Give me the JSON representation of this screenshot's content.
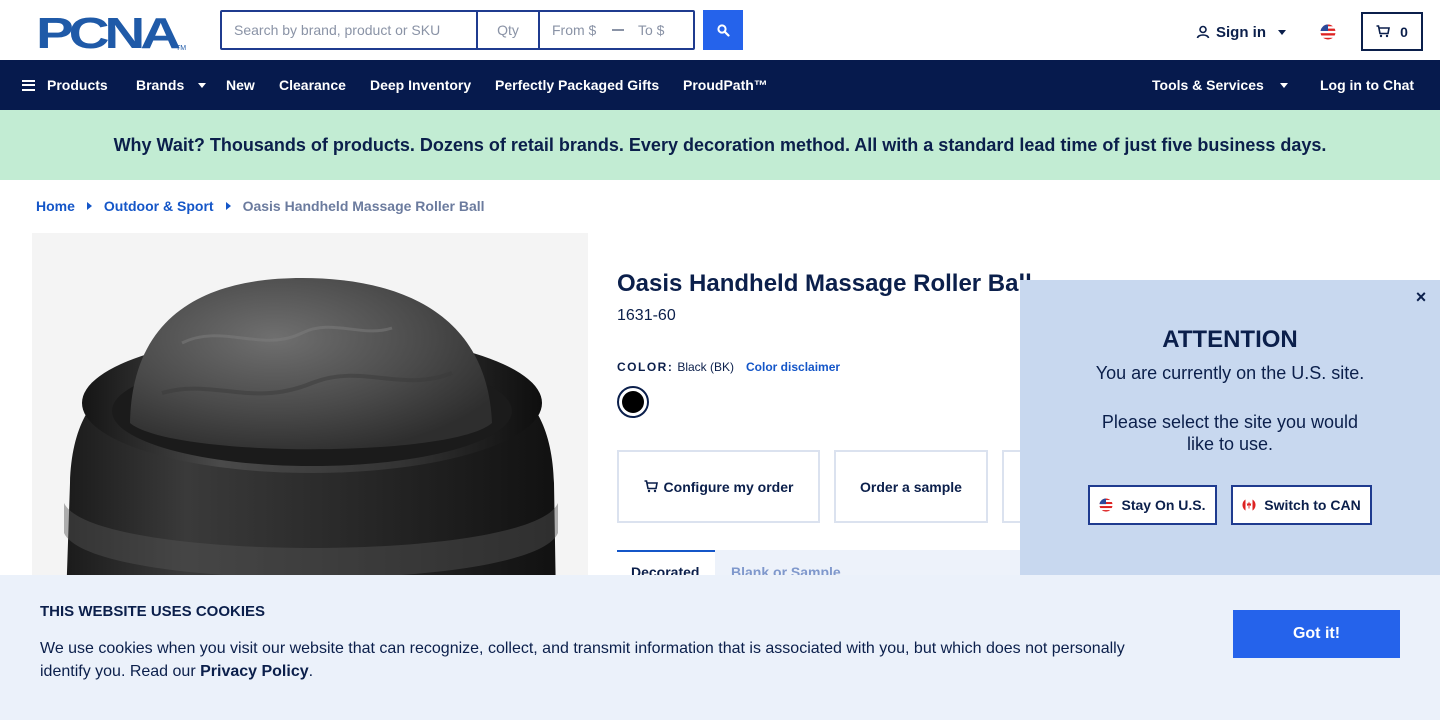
{
  "header": {
    "logo_text": "PCNA",
    "search": {
      "sku_placeholder": "Search by brand, product or SKU",
      "qty_placeholder": "Qty",
      "from_placeholder": "From $",
      "to_placeholder": "To $"
    },
    "sign_in_label": "Sign in",
    "cart_count": "0",
    "brand_color": "#1f5aa8"
  },
  "nav": {
    "products": "Products",
    "brands": "Brands",
    "new": "New",
    "clearance": "Clearance",
    "deep_inventory": "Deep Inventory",
    "gifts": "Perfectly Packaged Gifts",
    "proudpath": "ProudPath™",
    "tools": "Tools & Services",
    "chat": "Log in to Chat"
  },
  "promo": {
    "text": "Why Wait? Thousands of products. Dozens of retail brands. Every decoration method. All with a standard lead time of just five business days."
  },
  "breadcrumb": {
    "home": "Home",
    "category": "Outdoor & Sport",
    "current": "Oasis Handheld Massage Roller Ball"
  },
  "product": {
    "title": "Oasis Handheld Massage Roller Ball",
    "sku": "1631-60",
    "color_label": "COLOR:",
    "color_value": "Black (BK)",
    "color_disclaimer": "Color disclaimer",
    "swatch_color": "#000000",
    "configure_label": "Configure my order",
    "sample_label": "Order a sample",
    "tabs": [
      {
        "label": "Decorated"
      },
      {
        "label": "Blank or Sample"
      }
    ]
  },
  "attention": {
    "title": "ATTENTION",
    "line1": "You are currently on the U.S. site.",
    "line2": "Please select the site you would like to use.",
    "stay_label": "Stay On U.S.",
    "switch_label": "Switch to CAN",
    "close_label": "×"
  },
  "cookie": {
    "title": "THIS WEBSITE USES COOKIES",
    "text": "We use cookies when you visit our website that can recognize, collect, and transmit information that is associated with you, but which does not personally identify you. Read our ",
    "privacy_link": "Privacy Policy",
    "period": ".",
    "button_label": "Got it!"
  }
}
